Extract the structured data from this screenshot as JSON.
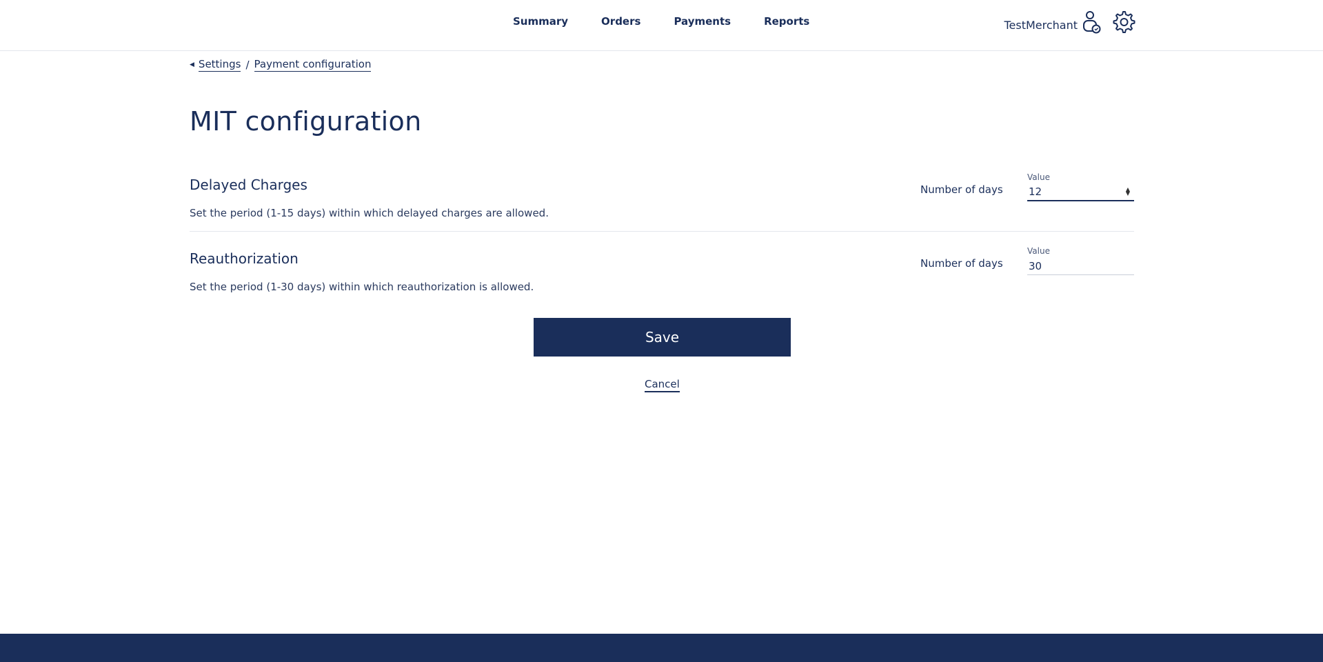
{
  "nav": {
    "items": [
      {
        "label": "Summary"
      },
      {
        "label": "Orders"
      },
      {
        "label": "Payments"
      },
      {
        "label": "Reports"
      }
    ]
  },
  "user": {
    "merchant_name": "TestMerchant",
    "account_icon": "account-icon",
    "settings_icon": "gear-icon"
  },
  "breadcrumb": {
    "back_icon": "caret-left-icon",
    "items": [
      {
        "label": "Settings"
      },
      {
        "label": "Payment configuration"
      }
    ],
    "separator": "/"
  },
  "page": {
    "title": "MIT configuration"
  },
  "sections": [
    {
      "title": "Delayed Charges",
      "description": "Set the period (1-15 days) within which delayed charges are allowed.",
      "days_label": "Number of days",
      "field_label": "Value",
      "value": "12"
    },
    {
      "title": "Reauthorization",
      "description": "Set the period (1-30 days) within which reauthorization is allowed.",
      "days_label": "Number of days",
      "field_label": "Value",
      "value": "30"
    }
  ],
  "actions": {
    "save_label": "Save",
    "cancel_label": "Cancel"
  },
  "colors": {
    "brand": "#1a2e5a",
    "divider": "#e3e6ec"
  }
}
